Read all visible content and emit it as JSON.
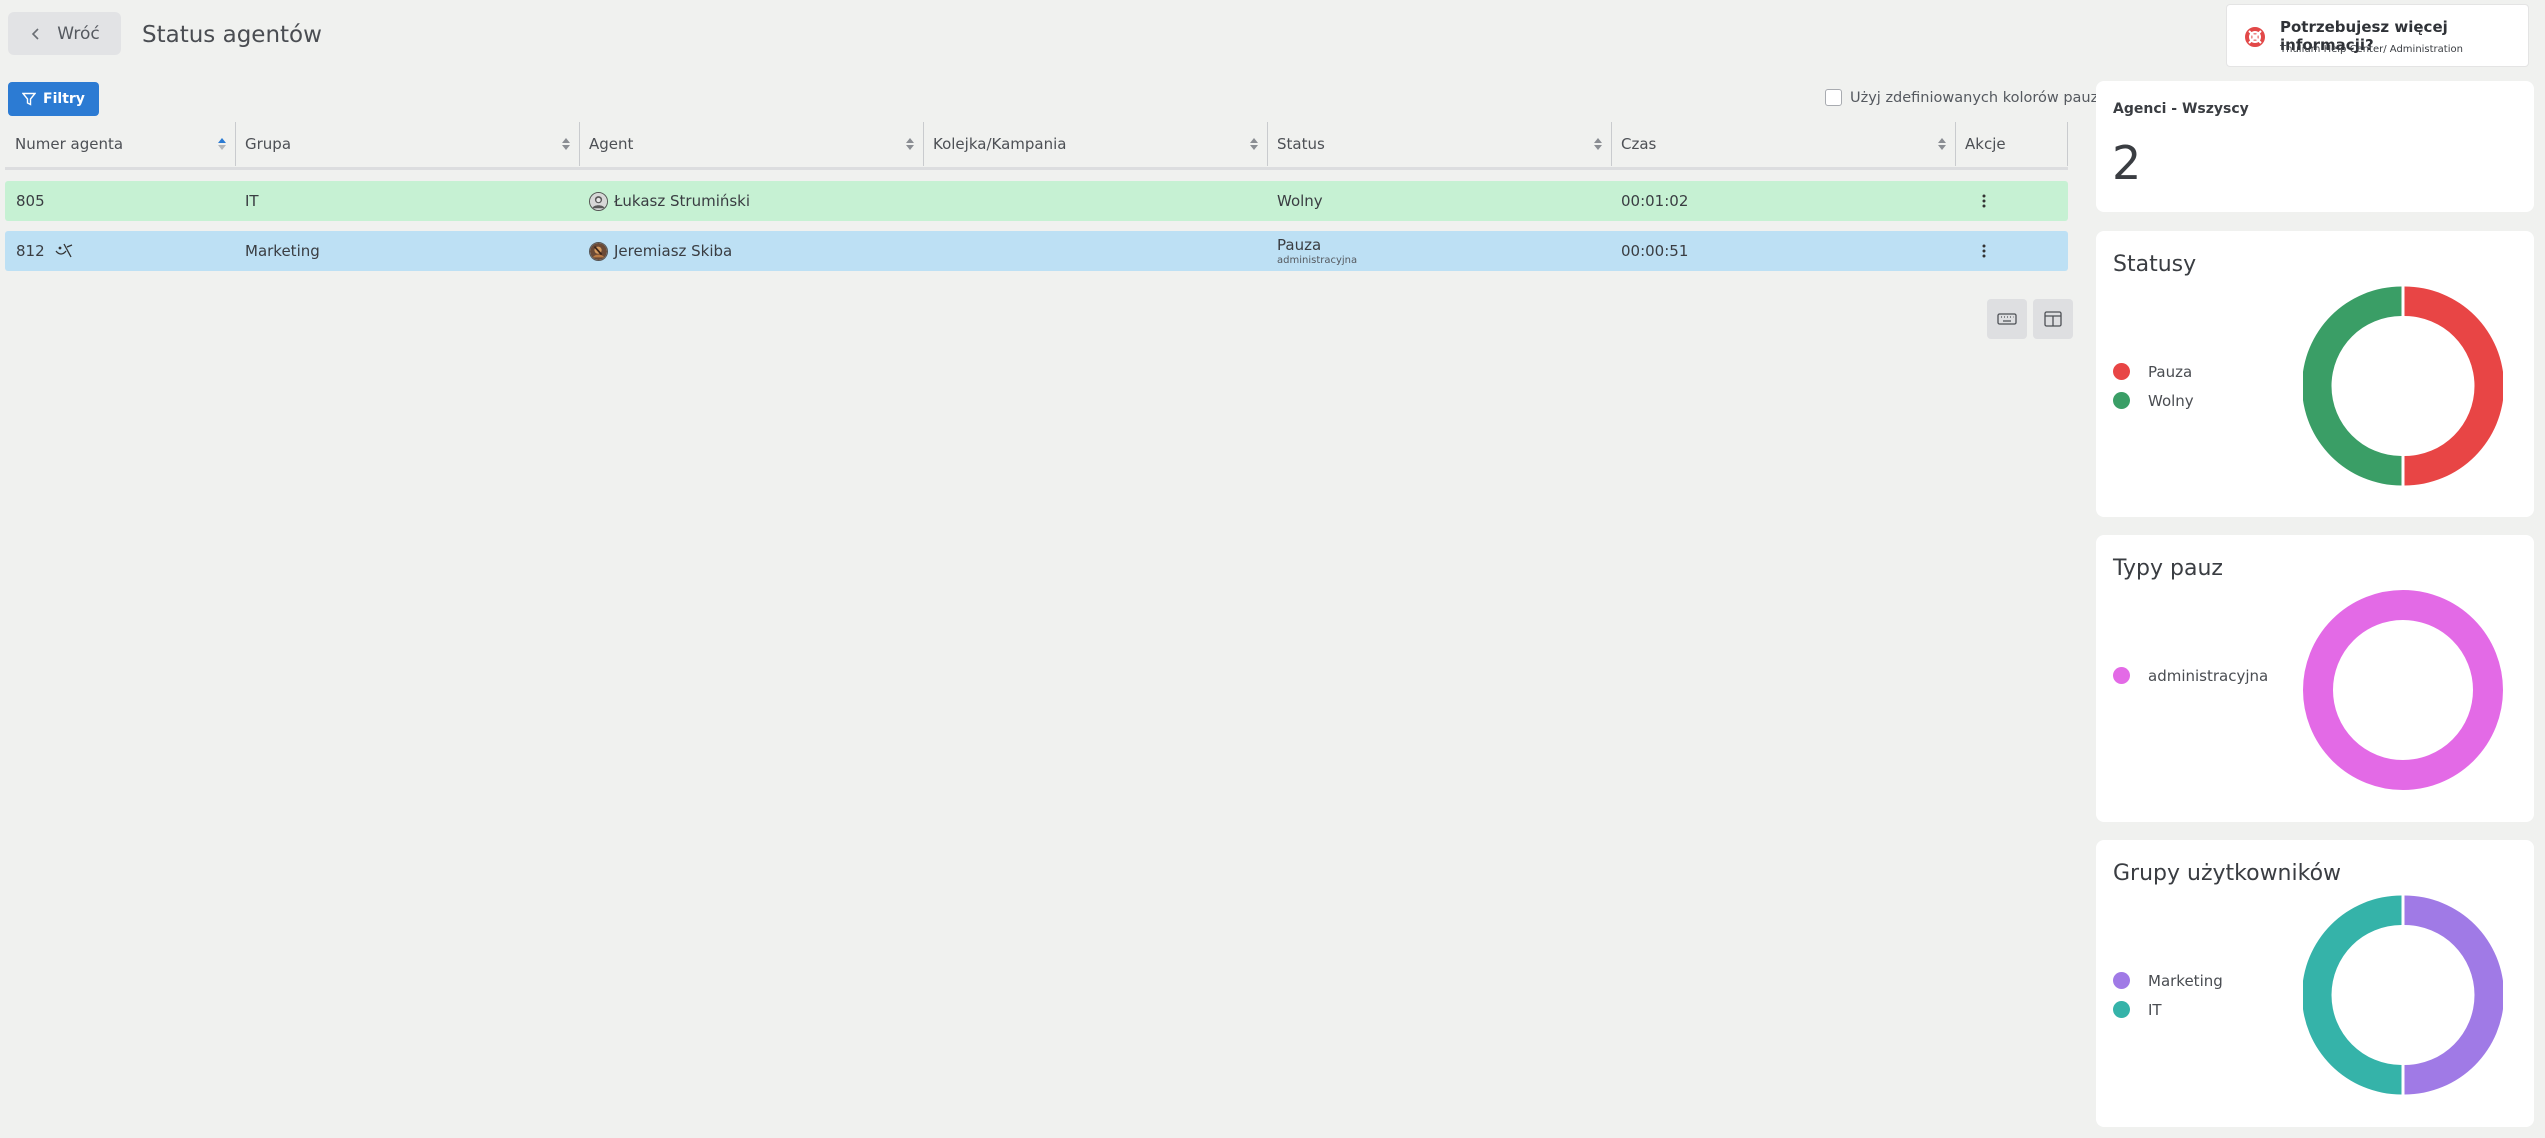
{
  "header": {
    "back_label": "Wróć",
    "title": "Status agentów"
  },
  "help": {
    "title": "Potrzebujesz więcej informacji?",
    "subtitle": "Thulium Help Center/ Administration"
  },
  "toolbar": {
    "filters_label": "Filtry",
    "pause_colors_label": "Użyj zdefiniowanych kolorów pauz",
    "pause_colors_checked": false
  },
  "table": {
    "columns": [
      "Numer agenta",
      "Grupa",
      "Agent",
      "Kolejka/Kampania",
      "Status",
      "Czas",
      "Akcje"
    ],
    "sorted_column": "Numer agenta",
    "sort_direction": "ascending",
    "rows": [
      {
        "number": "805",
        "group": "IT",
        "agent": "Łukasz Strumiński",
        "queue": "",
        "status": "Wolny",
        "status_sub": "",
        "time": "00:01:02",
        "row_color": "#c6f1d3",
        "extra_icon": ""
      },
      {
        "number": "812",
        "group": "Marketing",
        "agent": "Jeremiasz Skiba",
        "queue": "",
        "status": "Pauza",
        "status_sub": "administracyjna",
        "time": "00:00:51",
        "row_color": "#bde0f4",
        "extra_icon": "pause-emotion-icon"
      }
    ]
  },
  "panels": {
    "agents": {
      "label": "Agenci - Wszyscy",
      "count": "2"
    },
    "statuses": {
      "title": "Statusy",
      "legend": [
        {
          "label": "Pauza",
          "color": "#e84545",
          "value": 1
        },
        {
          "label": "Wolny",
          "color": "#3a9e66",
          "value": 1
        }
      ]
    },
    "pause_types": {
      "title": "Typy pauz",
      "legend": [
        {
          "label": "administracyjna",
          "color": "#e36ae6",
          "value": 1
        }
      ]
    },
    "user_groups": {
      "title": "Grupy użytkowników",
      "legend": [
        {
          "label": "Marketing",
          "color": "#a07ae6",
          "value": 1
        },
        {
          "label": "IT",
          "color": "#35b3a9",
          "value": 1
        }
      ]
    }
  }
}
